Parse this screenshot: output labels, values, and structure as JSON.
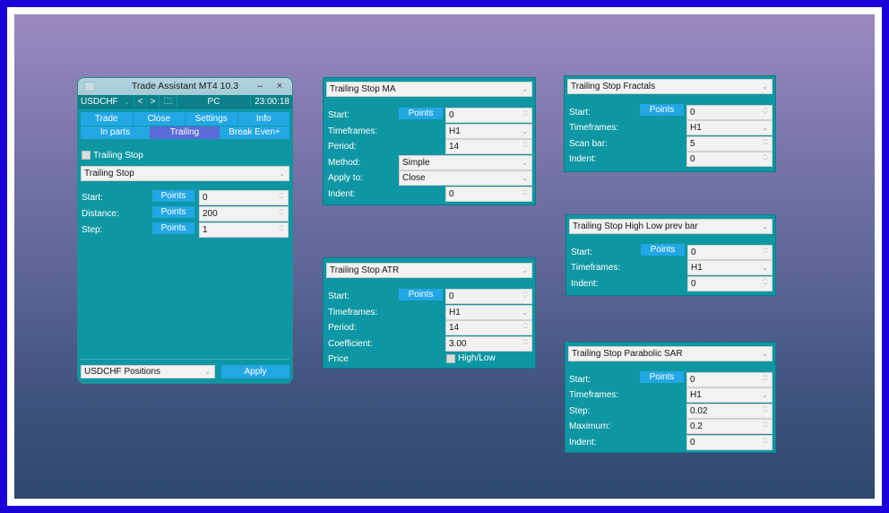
{
  "window": {
    "title": "Trade Assistant MT4 10.3",
    "minimize_label": "–",
    "close_label": "×"
  },
  "symbolbar": {
    "symbol": "USDCHF",
    "dropdown_glyph": "⌄",
    "prev_label": "<",
    "next_label": ">",
    "folder_glyph": "🗀",
    "account_type": "PC",
    "time": "23:00:18"
  },
  "tabs": [
    {
      "label": "Trade"
    },
    {
      "label": "Close"
    },
    {
      "label": "Settings"
    },
    {
      "label": "Info"
    }
  ],
  "subtabs": [
    {
      "label": "In parts",
      "active": false
    },
    {
      "label": "Trailing",
      "active": true
    },
    {
      "label": "Break Even+",
      "active": false
    }
  ],
  "main": {
    "enable_label": "Trailing Stop",
    "enabled": false,
    "mode": "Trailing Stop",
    "fields": [
      {
        "label": "Start:",
        "unit": "Points",
        "value": "0"
      },
      {
        "label": "Distance:",
        "unit": "Points",
        "value": "200"
      },
      {
        "label": "Step:",
        "unit": "Points",
        "value": "1"
      }
    ],
    "positions_select": "USDCHF Positions",
    "apply_label": "Apply"
  },
  "glyphs": {
    "select_arrow": "⌄",
    "spin_up": "︿",
    "spin_down": "﹀"
  },
  "panels": {
    "ma": {
      "title": "Trailing Stop MA",
      "start_label": "Start:",
      "start_unit": "Points",
      "start_value": "0",
      "timeframes_label": "Timeframes:",
      "timeframes_value": "H1",
      "period_label": "Period:",
      "period_value": "14",
      "method_label": "Method:",
      "method_value": "Simple",
      "apply_to_label": "Apply to:",
      "apply_to_value": "Close",
      "indent_label": "Indent:",
      "indent_value": "0"
    },
    "atr": {
      "title": "Trailing Stop ATR",
      "start_label": "Start:",
      "start_unit": "Points",
      "start_value": "0",
      "timeframes_label": "Timeframes:",
      "timeframes_value": "H1",
      "period_label": "Period:",
      "period_value": "14",
      "coefficient_label": "Coefficient:",
      "coefficient_value": "3.00",
      "price_label": "Price",
      "price_option_label": "High/Low",
      "price_option_checked": false
    },
    "fractals": {
      "title": "Trailing Stop Fractals",
      "start_label": "Start:",
      "start_unit": "Points",
      "start_value": "0",
      "timeframes_label": "Timeframes:",
      "timeframes_value": "H1",
      "scan_bar_label": "Scan bar:",
      "scan_bar_value": "5",
      "indent_label": "Indent:",
      "indent_value": "0"
    },
    "highlow": {
      "title": "Trailing Stop High Low prev bar",
      "start_label": "Start:",
      "start_unit": "Points",
      "start_value": "0",
      "timeframes_label": "Timeframes:",
      "timeframes_value": "H1",
      "indent_label": "Indent:",
      "indent_value": "0"
    },
    "sar": {
      "title": "Trailing Stop Parabolic SAR",
      "start_label": "Start:",
      "start_unit": "Points",
      "start_value": "0",
      "timeframes_label": "Timeframes:",
      "timeframes_value": "H1",
      "step_label": "Step:",
      "step_value": "0.02",
      "maximum_label": "Maximum:",
      "maximum_value": "0.2",
      "indent_label": "Indent:",
      "indent_value": "0"
    }
  }
}
